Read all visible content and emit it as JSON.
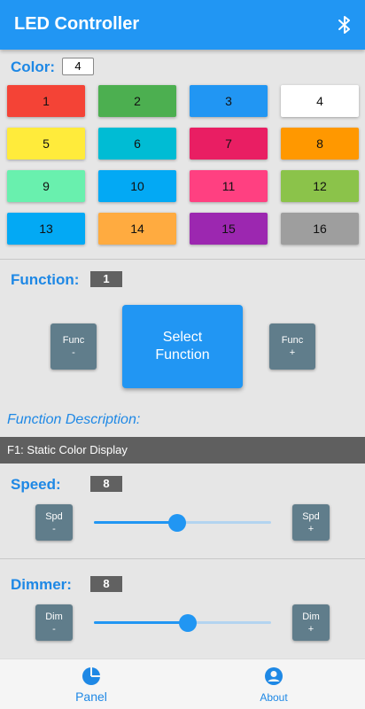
{
  "app": {
    "title": "LED Controller"
  },
  "color": {
    "label": "Color:",
    "value": "4",
    "swatches": [
      {
        "label": "1",
        "color": "#f44336"
      },
      {
        "label": "2",
        "color": "#4caf50"
      },
      {
        "label": "3",
        "color": "#2196f3"
      },
      {
        "label": "4",
        "color": "#ffffff"
      },
      {
        "label": "5",
        "color": "#ffeb3b"
      },
      {
        "label": "6",
        "color": "#00bcd4"
      },
      {
        "label": "7",
        "color": "#e91e63"
      },
      {
        "label": "8",
        "color": "#ff9800"
      },
      {
        "label": "9",
        "color": "#69f0ae"
      },
      {
        "label": "10",
        "color": "#03a9f4"
      },
      {
        "label": "11",
        "color": "#ff4081"
      },
      {
        "label": "12",
        "color": "#8bc34a"
      },
      {
        "label": "13",
        "color": "#03a9f4"
      },
      {
        "label": "14",
        "color": "#ffab40"
      },
      {
        "label": "15",
        "color": "#9c27b0"
      },
      {
        "label": "16",
        "color": "#9e9e9e"
      }
    ]
  },
  "function": {
    "label": "Function:",
    "value": "1",
    "prev_line1": "Func",
    "prev_line2": "-",
    "next_line1": "Func",
    "next_line2": "+",
    "select_line1": "Select",
    "select_line2": "Function",
    "description_label": "Function Description:",
    "description": "F1: Static Color Display"
  },
  "speed": {
    "label": "Speed:",
    "value": "8",
    "level_fraction": 0.47,
    "minus_line1": "Spd",
    "minus_line2": "-",
    "plus_line1": "Spd",
    "plus_line2": "+"
  },
  "dimmer": {
    "label": "Dimmer:",
    "value": "8",
    "level_fraction": 0.53,
    "minus_line1": "Dim",
    "minus_line2": "-",
    "plus_line1": "Dim",
    "plus_line2": "+"
  },
  "nav": {
    "panel_label": "Panel",
    "panel_icon": "pie-chart-icon",
    "about_label": "About",
    "about_icon": "account-circle-icon"
  },
  "theme": {
    "accent": "#2196f3",
    "button_gray": "#607d8b"
  }
}
